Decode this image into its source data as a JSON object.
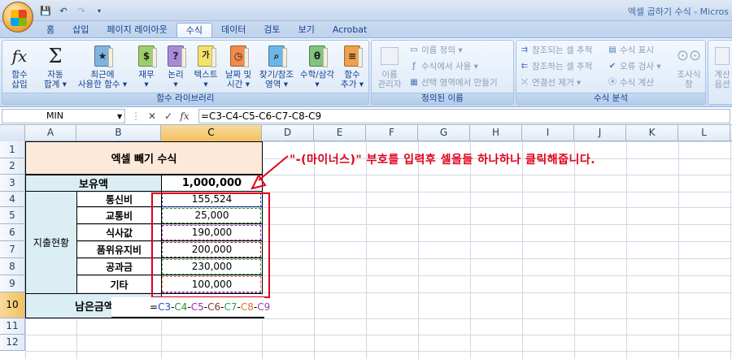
{
  "window": {
    "title": "엑셀 곱하기 수식 - Micros"
  },
  "quick_access": {
    "icons": [
      "save-icon",
      "undo-icon",
      "redo-icon",
      "customize-icon"
    ]
  },
  "tabs": [
    "홈",
    "삽입",
    "페이지 레이아웃",
    "수식",
    "데이터",
    "검토",
    "보기",
    "Acrobat"
  ],
  "active_tab": "수식",
  "ribbon": {
    "function_library": {
      "label": "함수 라이브러리",
      "insert_function": "함수\n삽입",
      "autosum": "자동\n합계 ▾",
      "recent": "최근에\n사용한 함수 ▾",
      "financial": "재무\n▾",
      "logical": "논리\n▾",
      "text": "텍스트\n▾",
      "datetime": "날짜 및\n시간 ▾",
      "lookup": "찾기/참조\n영역 ▾",
      "math": "수학/삼각\n▾",
      "more": "함수\n추가 ▾"
    },
    "defined_names": {
      "label": "정의된 이름",
      "name_manager": "이름\n관리자",
      "define_name": "이름 정의 ▾",
      "use_in_formula": "수식에서 사용 ▾",
      "create_from_selection": "선택 영역에서 만들기"
    },
    "formula_auditing": {
      "label": "수식 분석",
      "trace_precedents": "참조되는 셀 추적",
      "trace_dependents": "참조하는 셀 추적",
      "remove_arrows": "연결선 제거 ▾",
      "show_formulas": "수식 표시",
      "error_checking": "오류 검사 ▾",
      "evaluate_formula": "수식 계산",
      "watch_window": "조사식\n창"
    },
    "calculation": {
      "calc_options": "계산\n옵션"
    }
  },
  "formula_bar": {
    "name_box": "MIN",
    "formula": "=C3-C4-C5-C6-C7-C8-C9"
  },
  "sheet": {
    "columns": [
      "A",
      "B",
      "C",
      "D",
      "E",
      "F",
      "G",
      "H",
      "I",
      "J",
      "K",
      "L"
    ],
    "rows": [
      "1",
      "2",
      "3",
      "4",
      "5",
      "6",
      "7",
      "8",
      "9",
      "10",
      "11",
      "12"
    ],
    "title": "엑셀 빼기 수식",
    "holdings_label": "보유액",
    "holdings_value": "1,000,000",
    "expense_group_label": "지출현황",
    "expenses": [
      {
        "label": "통신비",
        "value": "155,524"
      },
      {
        "label": "교통비",
        "value": "25,000"
      },
      {
        "label": "식사값",
        "value": "190,000"
      },
      {
        "label": "품위유지비",
        "value": "200,000"
      },
      {
        "label": "공과금",
        "value": "230,000"
      },
      {
        "label": "기타",
        "value": "100,000"
      }
    ],
    "remaining_label": "남은금액",
    "editing_formula_parts": [
      "=",
      "C3",
      "-",
      "C4",
      "-",
      "C5",
      "-",
      "C6",
      "-",
      "C7",
      "-",
      "C8",
      "-",
      "C9"
    ]
  },
  "annotation": {
    "text": "\"-(마이너스)\"  부호를 입력후 셀을들 하나하나 클릭해줍니다."
  },
  "colors": {
    "title_fill": "#fde9d9",
    "header_fill": "#dbeef3",
    "annotation": "#e0001a",
    "ref_colors": [
      "#1f4fd1",
      "#2e8b2e",
      "#9b2fae",
      "#7b3f1e",
      "#27a35a",
      "#e8702a",
      "#8e44ad"
    ]
  }
}
